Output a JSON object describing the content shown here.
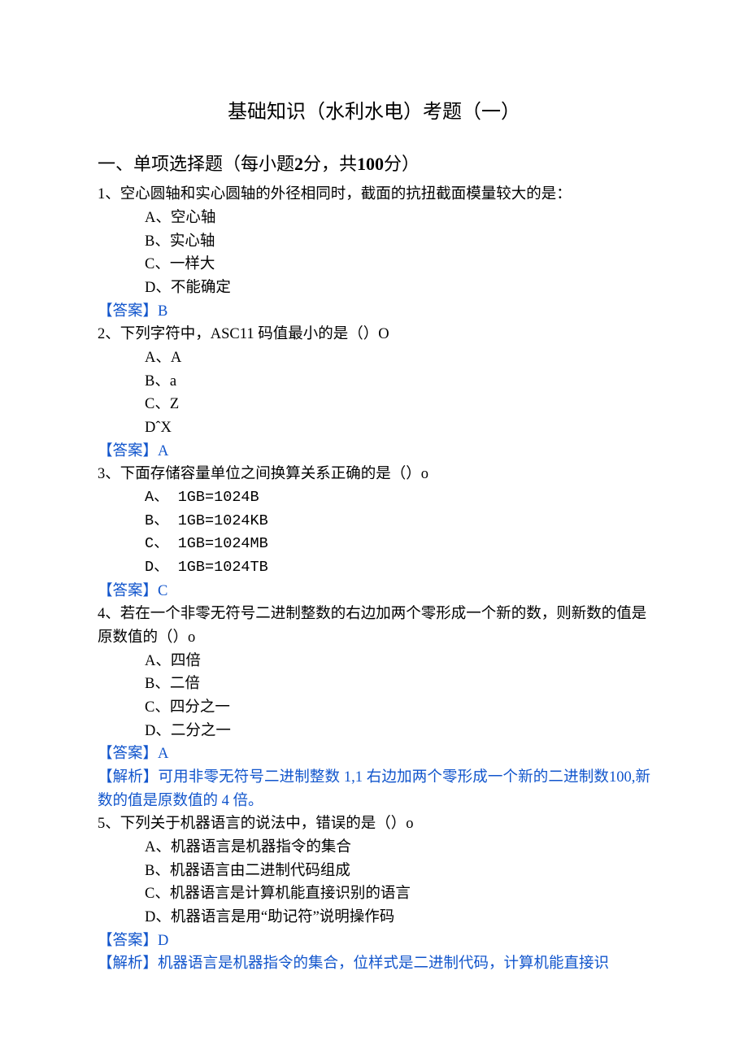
{
  "title": "基础知识（水利水电）考题（一）",
  "section_title_prefix": "一、单项选择题（每小题",
  "section_title_pts": "2",
  "section_title_mid": "分，共",
  "section_title_total": "100",
  "section_title_suffix": "分）",
  "answer_label": "【答案】",
  "explain_label": "【解析】",
  "questions": [
    {
      "num": "1、",
      "text": "空心圆轴和实心圆轴的外径相同时，截面的抗扭截面模量较大的是：",
      "opts": {
        "A": "A、空心轴",
        "B": "B、实心轴",
        "C": "C、一样大",
        "D": "D、不能确定"
      },
      "answer": "B"
    },
    {
      "num": "2、",
      "text": "下列字符中，ASC11 码值最小的是（）O",
      "opts": {
        "A": "A、A",
        "B": "B、a",
        "C": "C、Z",
        "D": "DˆX"
      },
      "answer": "A"
    },
    {
      "num": "3、",
      "text": "下面存储容量单位之间换算关系正确的是（）o",
      "opts": {
        "A": "A、 1GB=1024B",
        "B": "B、 1GB=1024KB",
        "C": "C、 1GB=1024MB",
        "D": "D、 1GB=1024TB"
      },
      "answer": "C"
    },
    {
      "num": "4、",
      "text": "若在一个非零无符号二进制整数的右边加两个零形成一个新的数，则新数的值是原数值的（）o",
      "opts": {
        "A": "A、四倍",
        "B": "B、二倍",
        "C": "C、四分之一",
        "D": "D、二分之一"
      },
      "answer": "A",
      "explain": "可用非零无符号二进制整数 1,1 右边加两个零形成一个新的二进制数100,新数的值是原数值的 4 倍。"
    },
    {
      "num": "5、",
      "text": "下列关于机器语言的说法中，错误的是（）o",
      "opts": {
        "A": "A、机器语言是机器指令的集合",
        "B": "B、机器语言由二进制代码组成",
        "C": "C、机器语言是计算机能直接识别的语言",
        "D": "D、机器语言是用“助记符”说明操作码"
      },
      "answer": "D",
      "explain": "机器语言是机器指令的集合，位样式是二进制代码，计算机能直接识"
    }
  ]
}
